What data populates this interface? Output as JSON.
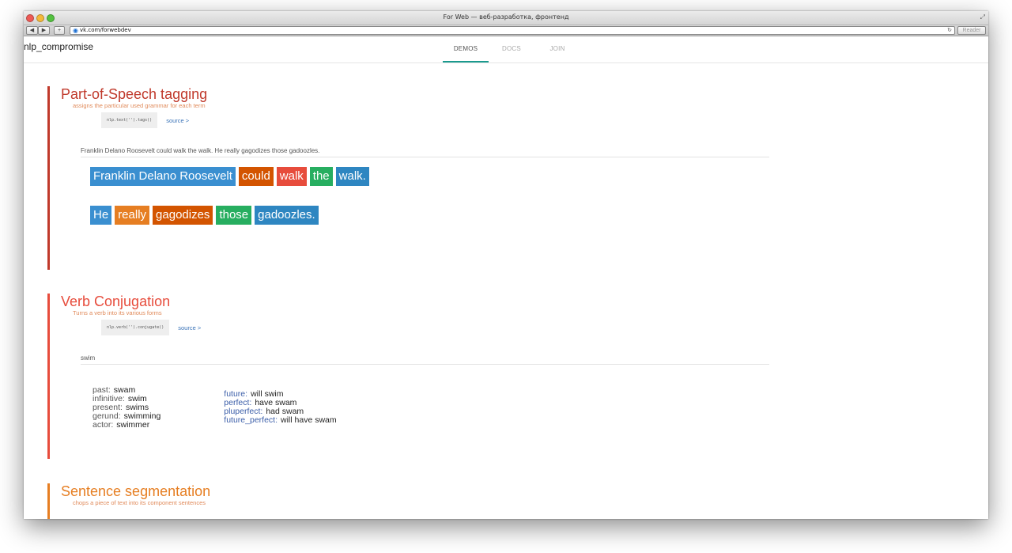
{
  "window": {
    "title": "For Web — веб-разработка, фронтенд",
    "url": "vk.com/forwebdev",
    "reader_label": "Reader",
    "back_glyph": "◀",
    "forward_glyph": "▶",
    "plus_glyph": "+"
  },
  "app": {
    "brand": "nlp_compromise",
    "tabs": [
      {
        "label": "DEMOS",
        "active": true
      },
      {
        "label": "DOCS",
        "active": false
      },
      {
        "label": "JOIN",
        "active": false
      }
    ]
  },
  "pos": {
    "title": "Part-of-Speech tagging",
    "subtitle": "assigns the particular used grammar for each term",
    "code": "nlp.text('').tags()",
    "source": "source >",
    "input": "Franklin Delano Roosevelt could walk the walk. He really gagodizes those gadoozles.",
    "lines": [
      [
        {
          "text": "Franklin Delano Roosevelt",
          "color": "#3a8fd0"
        },
        {
          "text": "could",
          "color": "#d35400"
        },
        {
          "text": "walk",
          "color": "#e74c3c"
        },
        {
          "text": "the",
          "color": "#27ae60"
        },
        {
          "text": "walk.",
          "color": "#2e86c1"
        }
      ],
      [
        {
          "text": "He",
          "color": "#3a8fd0"
        },
        {
          "text": "really",
          "color": "#e67e22"
        },
        {
          "text": "gagodizes",
          "color": "#d35400"
        },
        {
          "text": "those",
          "color": "#27ae60"
        },
        {
          "text": "gadoozles.",
          "color": "#2e86c1"
        }
      ]
    ]
  },
  "verb": {
    "title": "Verb Conjugation",
    "subtitle": "Turns a verb into its various forms",
    "code": "nlp.verb('').conjugate()",
    "source": "source >",
    "input": "swim",
    "col1": [
      {
        "key": "past:",
        "value": "swam"
      },
      {
        "key": "infinitive:",
        "value": "swim"
      },
      {
        "key": "present:",
        "value": "swims"
      },
      {
        "key": "gerund:",
        "value": "swimming"
      },
      {
        "key": "actor:",
        "value": "swimmer"
      }
    ],
    "col2": [
      {
        "key": "future:",
        "value": "will swim"
      },
      {
        "key": "perfect:",
        "value": "have swam"
      },
      {
        "key": "pluperfect:",
        "value": "had swam"
      },
      {
        "key": "future_perfect:",
        "value": "will have swam"
      }
    ]
  },
  "sentence": {
    "title": "Sentence segmentation",
    "subtitle": "chops a piece of text into its component sentences"
  },
  "colors": {
    "pos_accent": "#c0392b",
    "verb_accent": "#e74c3c",
    "sentence_accent": "#e67e22",
    "subtitle": "#e08a5a",
    "tab_active": "#1a9a8e"
  }
}
